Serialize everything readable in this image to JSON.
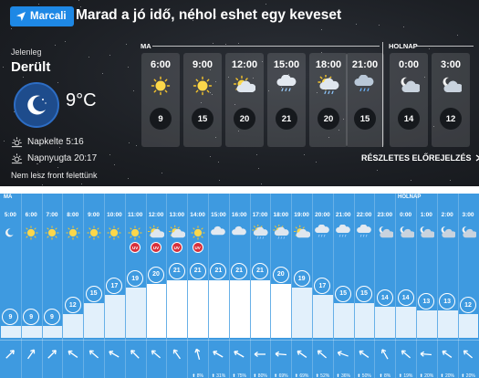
{
  "header": {
    "location_label": "Marcali",
    "headline": "Marad a jó idő, néhol eshet egy keveset"
  },
  "current": {
    "label": "Jelenleg",
    "condition": "Derült",
    "temperature": "9°C",
    "sunrise": "Napkelte 5:16",
    "sunset": "Napnyugta 20:17",
    "front_text": "Nem lesz front felettünk"
  },
  "forecast": {
    "today_label": "MA",
    "tomorrow_label": "HOLNAP",
    "details_link": "RÉSZLETES ELŐREJELZÉS",
    "hours": [
      {
        "time": "6:00",
        "icon": "sun-icon",
        "temp": "9"
      },
      {
        "time": "9:00",
        "icon": "sun-icon",
        "temp": "15"
      },
      {
        "time": "12:00",
        "icon": "sun-cloud-icon",
        "temp": "20"
      },
      {
        "time": "15:00",
        "icon": "cloud-rain-icon",
        "temp": "21"
      },
      {
        "time": "18:00",
        "icon": "sun-cloud-rain-icon",
        "temp": "20"
      },
      {
        "time": "21:00",
        "icon": "cloud-rain-dark-icon",
        "temp": "15"
      },
      {
        "time": "0:00",
        "icon": "night-cloud-icon",
        "temp": "14"
      },
      {
        "time": "3:00",
        "icon": "night-cloud-icon",
        "temp": "12"
      }
    ]
  },
  "hourly": {
    "today_label": "MA",
    "tomorrow_label": "HOLNAP",
    "hours": [
      {
        "time": "5:00",
        "icon": "moon-icon",
        "temp": "9",
        "uv": "",
        "wind": "",
        "wind_dir": 225
      },
      {
        "time": "6:00",
        "icon": "sun-icon",
        "temp": "9",
        "uv": "",
        "wind": "",
        "wind_dir": 215
      },
      {
        "time": "7:00",
        "icon": "sun-icon",
        "temp": "9",
        "uv": "",
        "wind": "",
        "wind_dir": 225
      },
      {
        "time": "8:00",
        "icon": "sun-icon",
        "temp": "12",
        "uv": "",
        "wind": "",
        "wind_dir": 125
      },
      {
        "time": "9:00",
        "icon": "sun-icon",
        "temp": "15",
        "uv": "",
        "wind": "",
        "wind_dir": 130
      },
      {
        "time": "10:00",
        "icon": "sun-icon",
        "temp": "17",
        "uv": "",
        "wind": "",
        "wind_dir": 120
      },
      {
        "time": "11:00",
        "icon": "sun-icon",
        "temp": "19",
        "uv": "UV",
        "wind": "",
        "wind_dir": 135
      },
      {
        "time": "12:00",
        "icon": "sun-cloud-icon",
        "temp": "20",
        "uv": "UV",
        "wind": "",
        "wind_dir": 130
      },
      {
        "time": "13:00",
        "icon": "sun-cloud-icon",
        "temp": "21",
        "uv": "UV",
        "wind": "",
        "wind_dir": 145
      },
      {
        "time": "14:00",
        "icon": "sun-icon",
        "temp": "21",
        "uv": "UV",
        "wind": "8%",
        "wind_dir": 165
      },
      {
        "time": "15:00",
        "icon": "cloud-icon",
        "temp": "21",
        "uv": "",
        "wind": "31%",
        "wind_dir": 120
      },
      {
        "time": "16:00",
        "icon": "cloud-icon",
        "temp": "21",
        "uv": "",
        "wind": "75%",
        "wind_dir": 120
      },
      {
        "time": "17:00",
        "icon": "sun-cloud-rain-icon",
        "temp": "21",
        "uv": "",
        "wind": "80%",
        "wind_dir": 90
      },
      {
        "time": "18:00",
        "icon": "sun-cloud-rain-icon",
        "temp": "20",
        "uv": "",
        "wind": "69%",
        "wind_dir": 95
      },
      {
        "time": "19:00",
        "icon": "sun-cloud-icon",
        "temp": "19",
        "uv": "",
        "wind": "69%",
        "wind_dir": 125
      },
      {
        "time": "20:00",
        "icon": "cloud-rain-icon",
        "temp": "17",
        "uv": "",
        "wind": "52%",
        "wind_dir": 130
      },
      {
        "time": "21:00",
        "icon": "cloud-rain-icon",
        "temp": "15",
        "uv": "",
        "wind": "36%",
        "wind_dir": 110
      },
      {
        "time": "22:00",
        "icon": "cloud-rain-icon",
        "temp": "15",
        "uv": "",
        "wind": "50%",
        "wind_dir": 125
      },
      {
        "time": "23:00",
        "icon": "night-cloud-icon",
        "temp": "14",
        "uv": "",
        "wind": "8%",
        "wind_dir": 150
      },
      {
        "time": "0:00",
        "icon": "night-cloud-icon",
        "temp": "14",
        "uv": "",
        "wind": "19%",
        "wind_dir": 130
      },
      {
        "time": "1:00",
        "icon": "night-cloud-icon",
        "temp": "13",
        "uv": "",
        "wind": "20%",
        "wind_dir": 95
      },
      {
        "time": "2:00",
        "icon": "night-cloud-icon",
        "temp": "13",
        "uv": "",
        "wind": "20%",
        "wind_dir": 125
      },
      {
        "time": "3:00",
        "icon": "night-cloud-icon",
        "temp": "12",
        "uv": "",
        "wind": "20%",
        "wind_dir": 130
      }
    ]
  },
  "colors": {
    "accent": "#1e88e5",
    "hourly_bg": "#3e9ae0",
    "uv_badge": "#d8303b",
    "moon_badge": "#1e4c8c"
  }
}
